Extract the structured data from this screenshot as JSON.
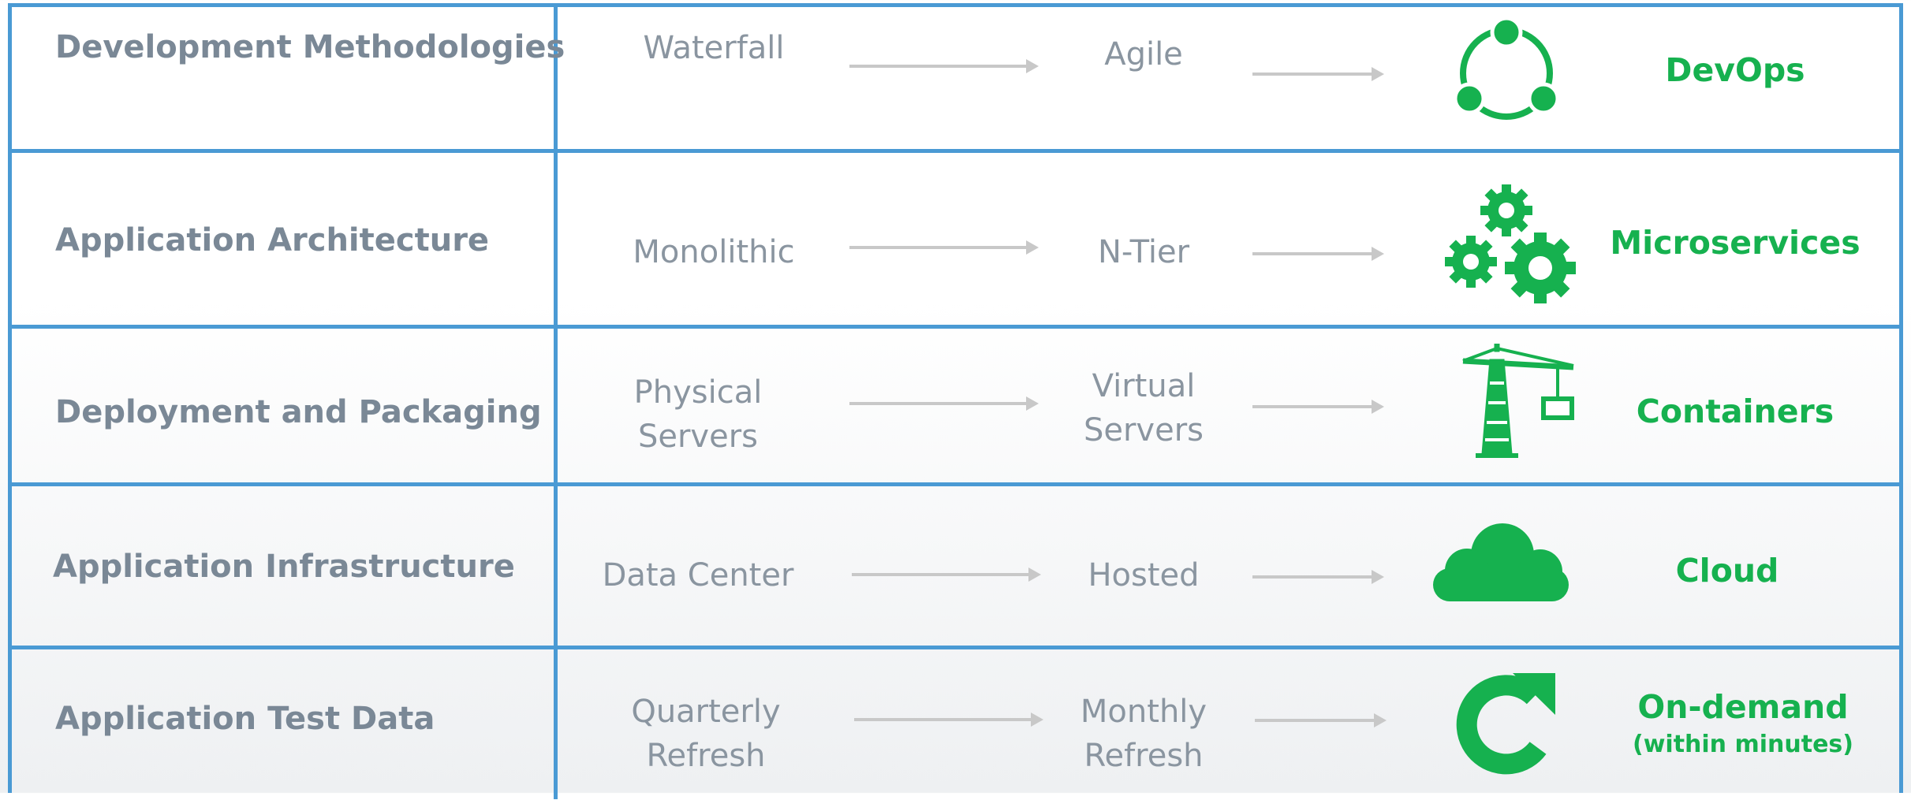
{
  "rows": [
    {
      "category": "Development Methodologies",
      "stage1": [
        "Waterfall"
      ],
      "stage2": [
        "Agile"
      ],
      "result": "DevOps",
      "result_sub": "",
      "icon": "devops-cycle-icon"
    },
    {
      "category": "Application Architecture",
      "stage1": [
        "Monolithic"
      ],
      "stage2": [
        "N-Tier"
      ],
      "result": "Microservices",
      "result_sub": "",
      "icon": "gears-icon"
    },
    {
      "category": "Deployment and Packaging",
      "stage1": [
        "Physical",
        "Servers"
      ],
      "stage2": [
        "Virtual",
        "Servers"
      ],
      "result": "Containers",
      "result_sub": "",
      "icon": "crane-icon"
    },
    {
      "category": "Application Infrastructure",
      "stage1": [
        "Data Center"
      ],
      "stage2": [
        "Hosted"
      ],
      "result": "Cloud",
      "result_sub": "",
      "icon": "cloud-icon"
    },
    {
      "category": "Application Test Data",
      "stage1": [
        "Quarterly",
        "Refresh"
      ],
      "stage2": [
        "Monthly",
        "Refresh"
      ],
      "result": "On-demand",
      "result_sub": "(within minutes)",
      "icon": "refresh-icon"
    }
  ],
  "colors": {
    "border": "#4a9ad4",
    "accent": "#16b14f",
    "label": "#7a8896",
    "stage": "#8a95a0",
    "arrow": "#c8c8c8"
  }
}
